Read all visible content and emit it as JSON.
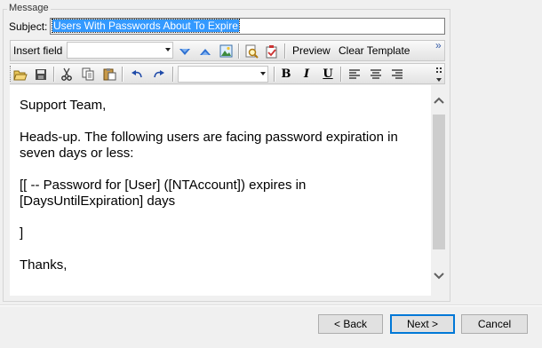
{
  "group": {
    "title": "Message"
  },
  "subject": {
    "label": "Subject:",
    "value": "Users With Passwords About To Expire"
  },
  "toolbar1": {
    "insert_field_label": "Insert field",
    "insert_field_value": "",
    "preview_label": "Preview",
    "clear_template_label": "Clear Template",
    "overflow_glyph": "»"
  },
  "toolbar2": {
    "font_combo_value": "",
    "bold": "B",
    "italic": "I",
    "underline": "U"
  },
  "editor": {
    "lines": [
      "Support Team,",
      "",
      "Heads-up.  The following users are facing password expiration in seven days or less:",
      "",
      "[[ -- Password for [User] ([NTAccount]) expires in [DaysUntilExpiration] days",
      "",
      "]",
      "",
      "Thanks,"
    ]
  },
  "buttons": {
    "back": "< Back",
    "next": "Next >",
    "cancel": "Cancel"
  },
  "icons": {
    "move_down": "arrow-down-blue-icon",
    "move_up": "arrow-up-blue-icon",
    "insert_image": "image-icon",
    "find": "find-icon",
    "check": "checklist-icon",
    "open": "open-folder-icon",
    "save": "save-disk-icon",
    "cut": "cut-icon",
    "copy": "copy-icon",
    "paste": "paste-icon",
    "undo": "undo-icon",
    "redo": "redo-icon"
  },
  "colors": {
    "selection": "#3399ff",
    "accent": "#0078d7",
    "icon_blue": "#2c6fd1"
  }
}
